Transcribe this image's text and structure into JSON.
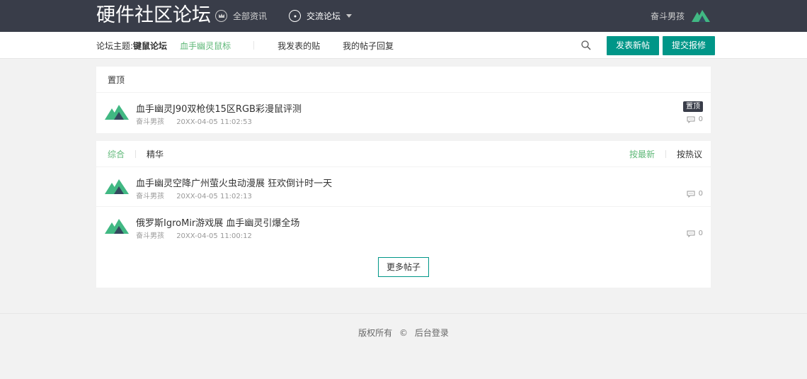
{
  "header": {
    "brand": "硬件社区论坛",
    "nav": [
      {
        "label": "全部资讯",
        "icon": "crown-icon"
      },
      {
        "label": "交流论坛",
        "icon": "chat-icon"
      }
    ],
    "user_name": "奋斗男孩"
  },
  "subbar": {
    "topic_label": "论坛主题: ",
    "topic": "键鼠论坛",
    "sub_topic": "血手幽灵鼠标",
    "my_posts": "我发表的贴",
    "my_replies": "我的帖子回复",
    "new_post_button": "发表新帖",
    "report_button": "提交报修"
  },
  "pinned_panel": {
    "heading": "置顶",
    "posts": [
      {
        "title": "血手幽灵J90双枪侠15区RGB彩漫鼠评测",
        "author": "奋斗男孩",
        "time": "20XX-04-05 11:02:53",
        "badge": "置顶",
        "comments": "0"
      }
    ]
  },
  "list_panel": {
    "tabs": [
      "综合",
      "精华"
    ],
    "sort": [
      "按最新",
      "按热议"
    ],
    "posts": [
      {
        "title": "血手幽灵空降广州萤火虫动漫展 狂欢倒计时一天",
        "author": "奋斗男孩",
        "time": "20XX-04-05 11:02:13",
        "comments": "0"
      },
      {
        "title": "俄罗斯IgroMir游戏展 血手幽灵引爆全场",
        "author": "奋斗男孩",
        "time": "20XX-04-05 11:00:12",
        "comments": "0"
      }
    ],
    "more_button": "更多帖子"
  },
  "footer": {
    "copyright": "版权所有",
    "symbol": "©",
    "admin_login": "后台登录"
  },
  "colors": {
    "header_bg": "#393d49",
    "accent": "#009688",
    "active_green": "#5fb878"
  }
}
